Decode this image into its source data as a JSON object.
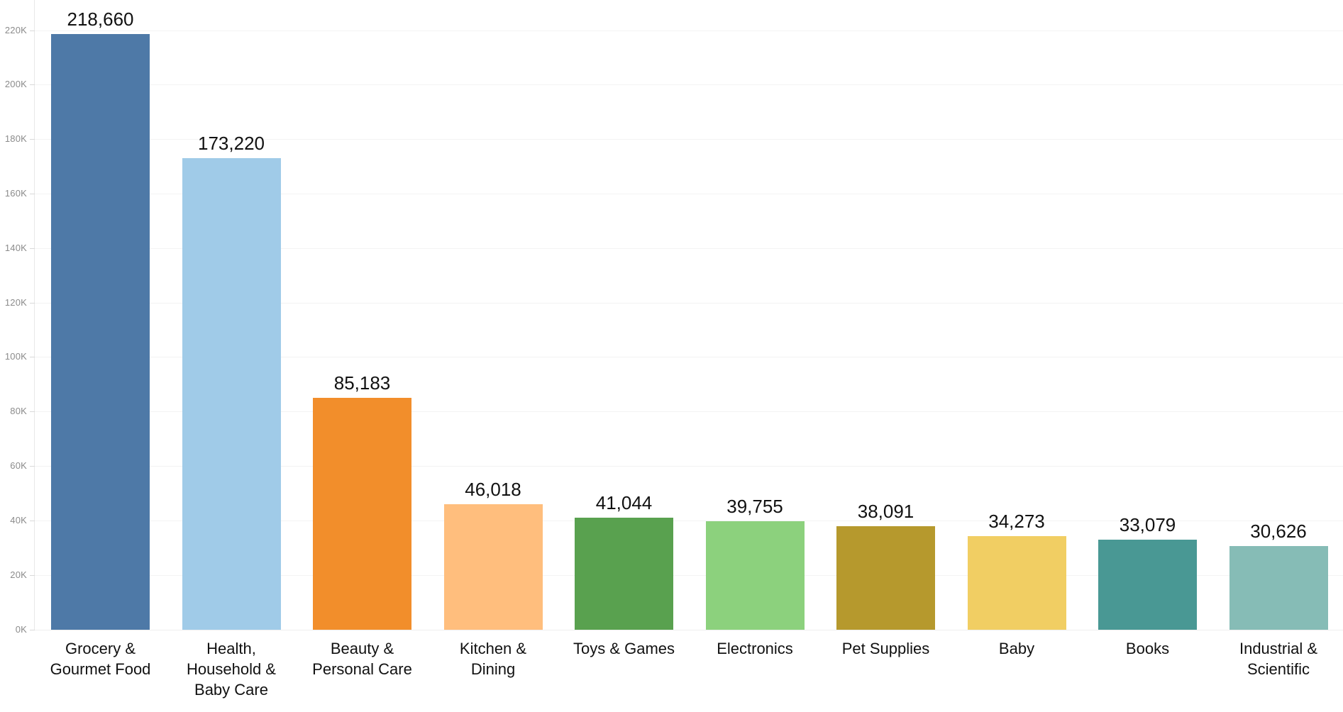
{
  "chart_data": {
    "type": "bar",
    "title": "",
    "subtitle": "",
    "xlabel": "",
    "ylabel": "",
    "categories": [
      "Grocery & Gourmet Food",
      "Health, Household & Baby Care",
      "Beauty & Personal Care",
      "Kitchen & Dining",
      "Toys & Games",
      "Electronics",
      "Pet Supplies",
      "Baby",
      "Books",
      "Industrial & Scientific"
    ],
    "values": [
      218660,
      173220,
      85183,
      46018,
      41044,
      39755,
      38091,
      34273,
      33079,
      30626
    ],
    "value_labels": [
      "218,660",
      "173,220",
      "85,183",
      "46,018",
      "41,044",
      "39,755",
      "38,091",
      "34,273",
      "33,079",
      "30,626"
    ],
    "bar_colors": [
      "#4E79A7",
      "#A0CBE8",
      "#F28E2B",
      "#FFBE7D",
      "#59A14F",
      "#8CD17D",
      "#B6992D",
      "#F1CE63",
      "#499894",
      "#86BCB6"
    ],
    "ylim": [
      0,
      228000
    ],
    "ytick_values": [
      0,
      20000,
      40000,
      60000,
      80000,
      100000,
      120000,
      140000,
      160000,
      180000,
      200000,
      220000
    ],
    "ytick_labels": [
      "0K",
      "20K",
      "40K",
      "60K",
      "80K",
      "100K",
      "120K",
      "140K",
      "160K",
      "180K",
      "200K",
      "220K"
    ],
    "grid": true,
    "grid_axis": "y",
    "legend": false,
    "legend_position": "none",
    "value_labels_shown": true,
    "background_color": "#FFFFFF",
    "gridline_color": "#F3F3F3",
    "axis_line_color": "#E8E8E8",
    "tick_label_color": "#8B8B8B",
    "value_label_color": "#111111",
    "category_label_color": "#111111"
  }
}
